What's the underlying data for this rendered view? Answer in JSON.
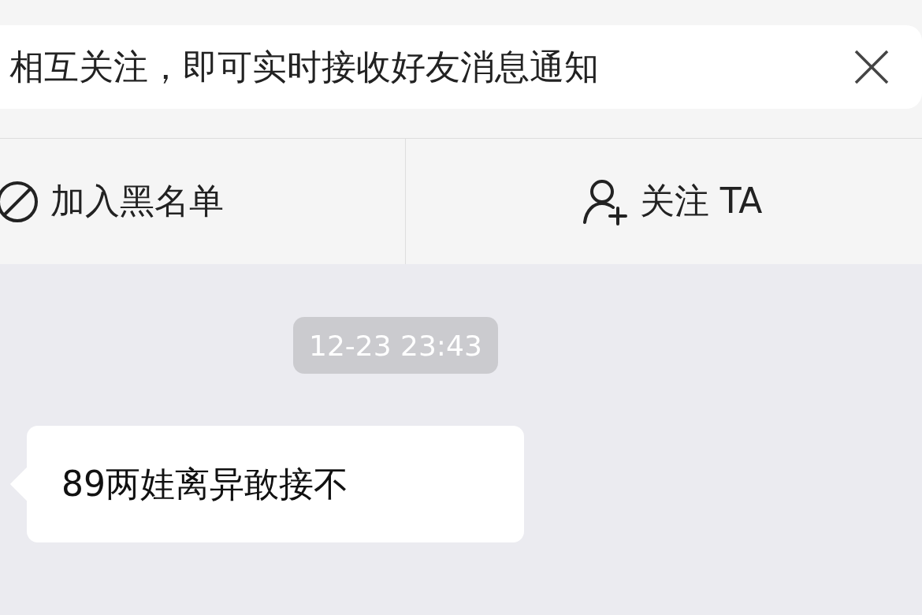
{
  "notice": {
    "text": "相互关注，即可实时接收好友消息通知"
  },
  "actions": [
    {
      "kind": "block",
      "label": "加入黑名单"
    },
    {
      "kind": "follow",
      "label": "关注 TA"
    }
  ],
  "messages": [
    {
      "kind": "time",
      "text": "12-23 23:43"
    },
    {
      "kind": "incoming",
      "text": "89两娃离异敢接不"
    }
  ]
}
